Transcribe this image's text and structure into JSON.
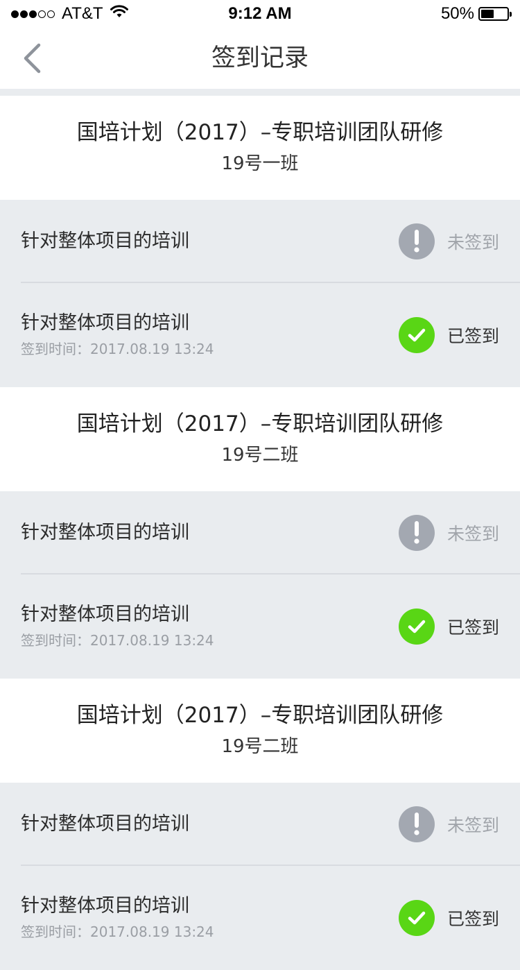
{
  "status_bar": {
    "carrier": "AT&T",
    "time": "9:12 AM",
    "battery_percent": "50%",
    "battery_level": 0.5
  },
  "nav": {
    "title": "签到记录",
    "back_icon": "chevron-left-icon"
  },
  "colors": {
    "accent_success": "#59d615",
    "pending_icon": "#a3a8b1",
    "background": "#e9ecef"
  },
  "groups": [
    {
      "title": "国培计划（2017）–专职培训团队研修",
      "subtitle": "19号一班",
      "records": [
        {
          "name": "针对整体项目的培训",
          "status": "未签到",
          "state": "pending"
        },
        {
          "name": "针对整体项目的培训",
          "time": "签到时间：2017.08.19 13:24",
          "status": "已签到",
          "state": "done"
        }
      ]
    },
    {
      "title": "国培计划（2017）–专职培训团队研修",
      "subtitle": "19号二班",
      "records": [
        {
          "name": "针对整体项目的培训",
          "status": "未签到",
          "state": "pending"
        },
        {
          "name": "针对整体项目的培训",
          "time": "签到时间：2017.08.19 13:24",
          "status": "已签到",
          "state": "done"
        }
      ]
    },
    {
      "title": "国培计划（2017）–专职培训团队研修",
      "subtitle": "19号二班",
      "records": [
        {
          "name": "针对整体项目的培训",
          "status": "未签到",
          "state": "pending"
        },
        {
          "name": "针对整体项目的培训",
          "time": "签到时间：2017.08.19 13:24",
          "status": "已签到",
          "state": "done"
        }
      ]
    }
  ]
}
